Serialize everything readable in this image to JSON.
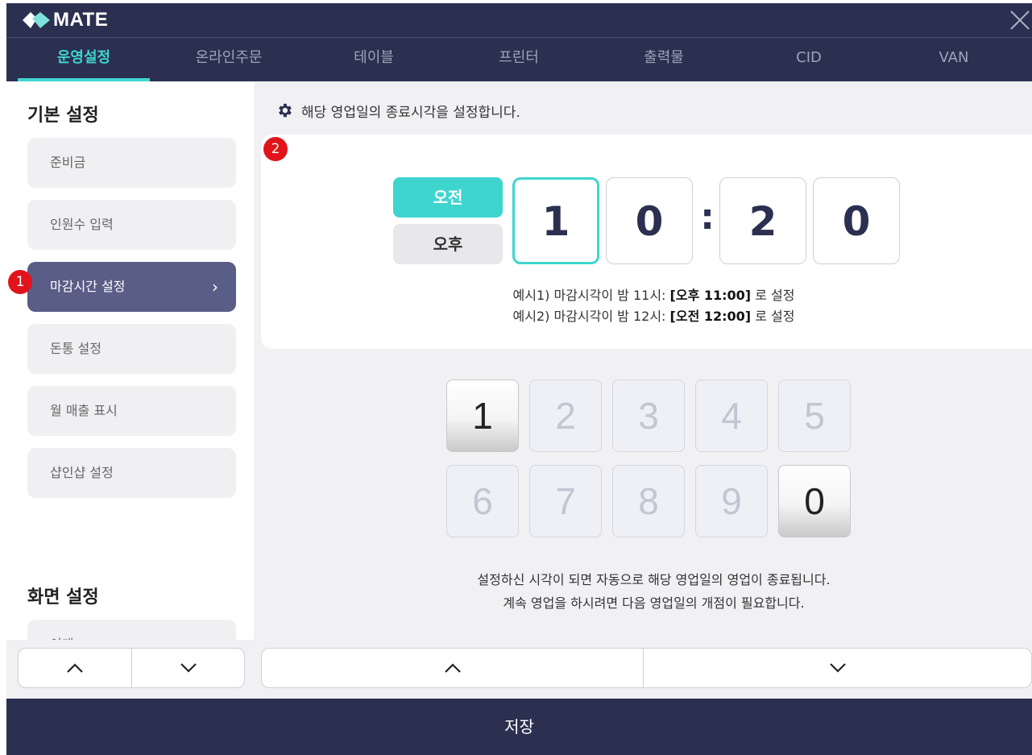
{
  "app": {
    "logo_text": "MATE",
    "logo_icon": "mate-logo-icon",
    "close_icon": "close-icon"
  },
  "tabs": [
    {
      "label": "운영설정",
      "active": true
    },
    {
      "label": "온라인주문",
      "active": false
    },
    {
      "label": "테이블",
      "active": false
    },
    {
      "label": "프린터",
      "active": false
    },
    {
      "label": "출력물",
      "active": false
    },
    {
      "label": "CID",
      "active": false
    },
    {
      "label": "VAN",
      "active": false
    }
  ],
  "sidebar": {
    "section1_title": "기본 설정",
    "items": [
      {
        "label": "준비금"
      },
      {
        "label": "인원수 입력"
      },
      {
        "label": "마감시간 설정",
        "active": true,
        "chevron": "›"
      },
      {
        "label": "돈통 설정"
      },
      {
        "label": "월 매출 표시"
      },
      {
        "label": "샵인샵 설정"
      }
    ],
    "section2_title": "화면 설정",
    "partial_item": "이게",
    "badge": "1"
  },
  "main": {
    "info_icon": "gear-icon",
    "info_text": "해당 영업일의 종료시각을 설정합니다.",
    "badge": "2",
    "ampm": {
      "am": "오전",
      "pm": "오후",
      "selected": "오전"
    },
    "time_digits": [
      "1",
      "0",
      "2",
      "0"
    ],
    "colon": ":",
    "example1_prefix": "예시1) 마감시각이 밤 11시: ",
    "example1_bold": "[오후 11:00]",
    "example1_suffix": " 로 설정",
    "example2_prefix": "예시2) 마감시각이 밤 12시: ",
    "example2_bold": "[오전 12:00]",
    "example2_suffix": " 로 설정",
    "keypad": [
      {
        "label": "1",
        "enabled": true
      },
      {
        "label": "2",
        "enabled": false
      },
      {
        "label": "3",
        "enabled": false
      },
      {
        "label": "4",
        "enabled": false
      },
      {
        "label": "5",
        "enabled": false
      },
      {
        "label": "6",
        "enabled": false
      },
      {
        "label": "7",
        "enabled": false
      },
      {
        "label": "8",
        "enabled": false
      },
      {
        "label": "9",
        "enabled": false
      },
      {
        "label": "0",
        "enabled": true
      }
    ],
    "note_line1": "설정하신 시각이 되면 자동으로 해당 영업일의 영업이 종료됩니다.",
    "note_line2": "계속 영업을 하시려면 다음 영업일의 개점이 필요합니다."
  },
  "footer": {
    "save_label": "저장"
  },
  "colors": {
    "navy": "#2b3050",
    "teal": "#3fd5cf",
    "active_item": "#5a5d86",
    "badge_red": "#e0141a"
  }
}
